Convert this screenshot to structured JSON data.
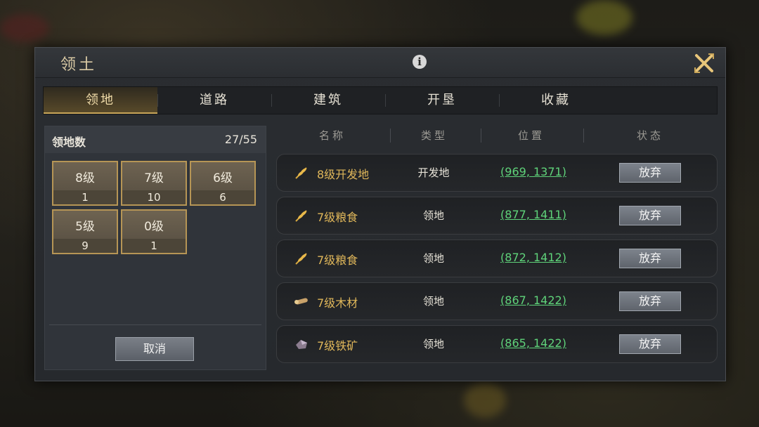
{
  "window": {
    "title": "领土"
  },
  "tabs": [
    {
      "label": "领地",
      "active": true
    },
    {
      "label": "道路",
      "active": false
    },
    {
      "label": "建筑",
      "active": false
    },
    {
      "label": "开垦",
      "active": false
    },
    {
      "label": "收藏",
      "active": false
    }
  ],
  "summary": {
    "label": "领地数",
    "count": "27/55",
    "levels": [
      {
        "name": "8级",
        "value": "1"
      },
      {
        "name": "7级",
        "value": "10"
      },
      {
        "name": "6级",
        "value": "6"
      },
      {
        "name": "5级",
        "value": "9"
      },
      {
        "name": "0级",
        "value": "1"
      }
    ],
    "cancel_label": "取消"
  },
  "table": {
    "headers": [
      "名称",
      "类型",
      "位置",
      "状态"
    ],
    "rows": [
      {
        "icon": "wheat-icon",
        "name": "8级开发地",
        "type": "开发地",
        "position": "(969, 1371)",
        "action": "放弃"
      },
      {
        "icon": "wheat-icon",
        "name": "7级粮食",
        "type": "领地",
        "position": "(877, 1411)",
        "action": "放弃"
      },
      {
        "icon": "wheat-icon",
        "name": "7级粮食",
        "type": "领地",
        "position": "(872, 1412)",
        "action": "放弃"
      },
      {
        "icon": "wood-icon",
        "name": "7级木材",
        "type": "领地",
        "position": "(867, 1422)",
        "action": "放弃"
      },
      {
        "icon": "iron-ore-icon",
        "name": "7级铁矿",
        "type": "领地",
        "position": "(865, 1422)",
        "action": "放弃"
      }
    ]
  },
  "colors": {
    "accent_gold": "#e0b75a",
    "coord_green": "#5fd37a",
    "panel_bg": "#2a2d31"
  }
}
